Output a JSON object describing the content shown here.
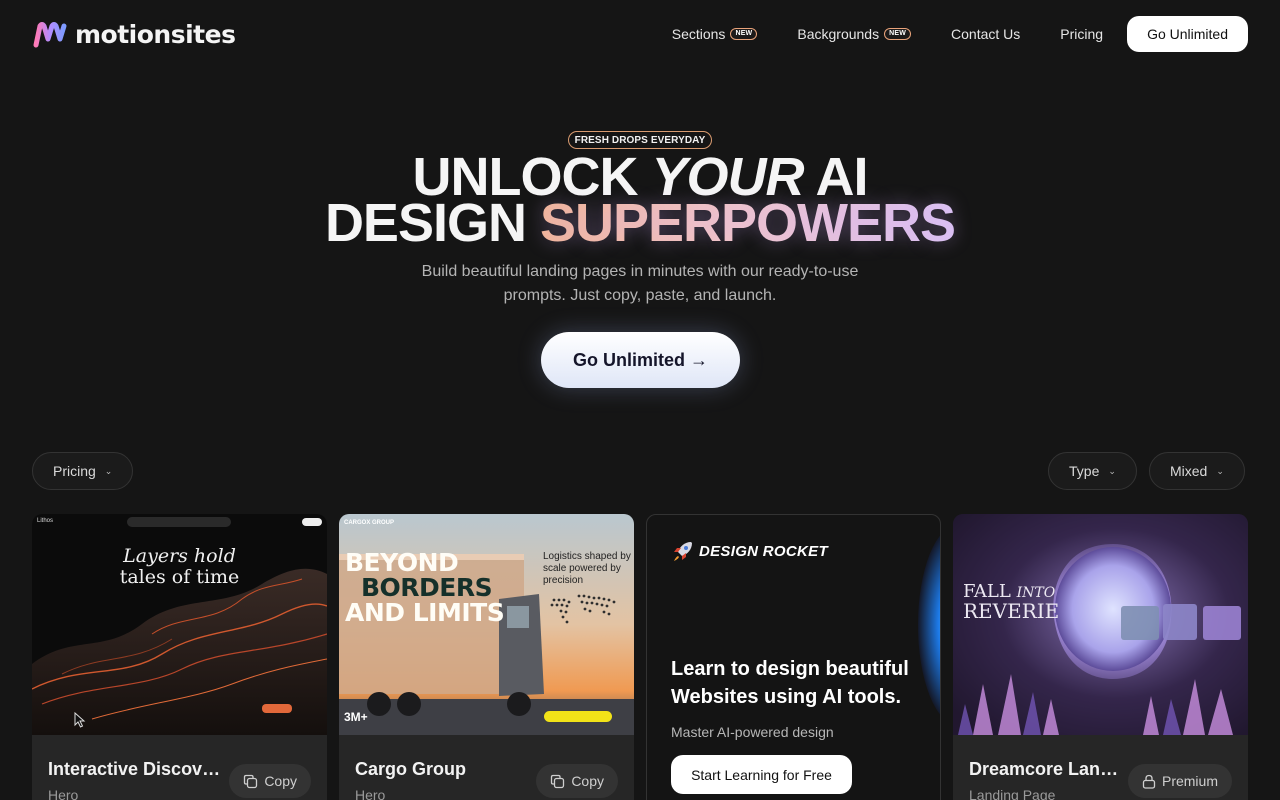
{
  "header": {
    "logo_text": "motionsites",
    "nav": [
      {
        "label": "Sections",
        "badge": "NEW"
      },
      {
        "label": "Backgrounds",
        "badge": "NEW"
      },
      {
        "label": "Contact Us"
      },
      {
        "label": "Pricing"
      }
    ],
    "cta_label": "Go Unlimited"
  },
  "hero": {
    "badge": "FRESH DROPS EVERYDAY",
    "title_line1_a": "UNLOCK ",
    "title_line1_b": "YOUR",
    "title_line1_c": " AI",
    "title_line2_a": "DESIGN ",
    "title_line2_b": "SUPERPOWERS",
    "subtitle": "Build beautiful landing pages in minutes with our ready-to-use prompts. Just copy, paste, and launch.",
    "cta_label": "Go Unlimited →"
  },
  "filters": {
    "pricing": "Pricing",
    "type": "Type",
    "sort": "Mixed"
  },
  "cards": [
    {
      "title": "Interactive Discovery",
      "category": "Hero",
      "action": "Copy",
      "preview_brand": "Lithos",
      "preview_heading_1": "Layers hold",
      "preview_heading_2": "tales of time"
    },
    {
      "title": "Cargo Group",
      "category": "Hero",
      "action": "Copy",
      "preview_brand": "CARGOX GROUP",
      "preview_heading_1": "BEYOND",
      "preview_heading_2": "BORDERS",
      "preview_heading_3": "AND LIMITS",
      "preview_side": "Logistics shaped by scale powered by precision",
      "preview_stat": "3M+"
    },
    {
      "title": "Dreamcore Landing Page",
      "category": "Landing Page",
      "action": "Premium",
      "preview_heading_1": "FALL",
      "preview_heading_2": "INTO",
      "preview_heading_3": "REVERIE"
    }
  ],
  "ad": {
    "brand": "DESIGN ROCKET",
    "title": "Learn to design beautiful Websites using AI tools.",
    "subtitle": "Master AI-powered design",
    "cta_label": "Start Learning for Free"
  },
  "colors": {
    "background": "#151515",
    "card": "#262626",
    "accent_gradient_start": "#f3b592",
    "accent_gradient_end": "#dbc2f2"
  }
}
